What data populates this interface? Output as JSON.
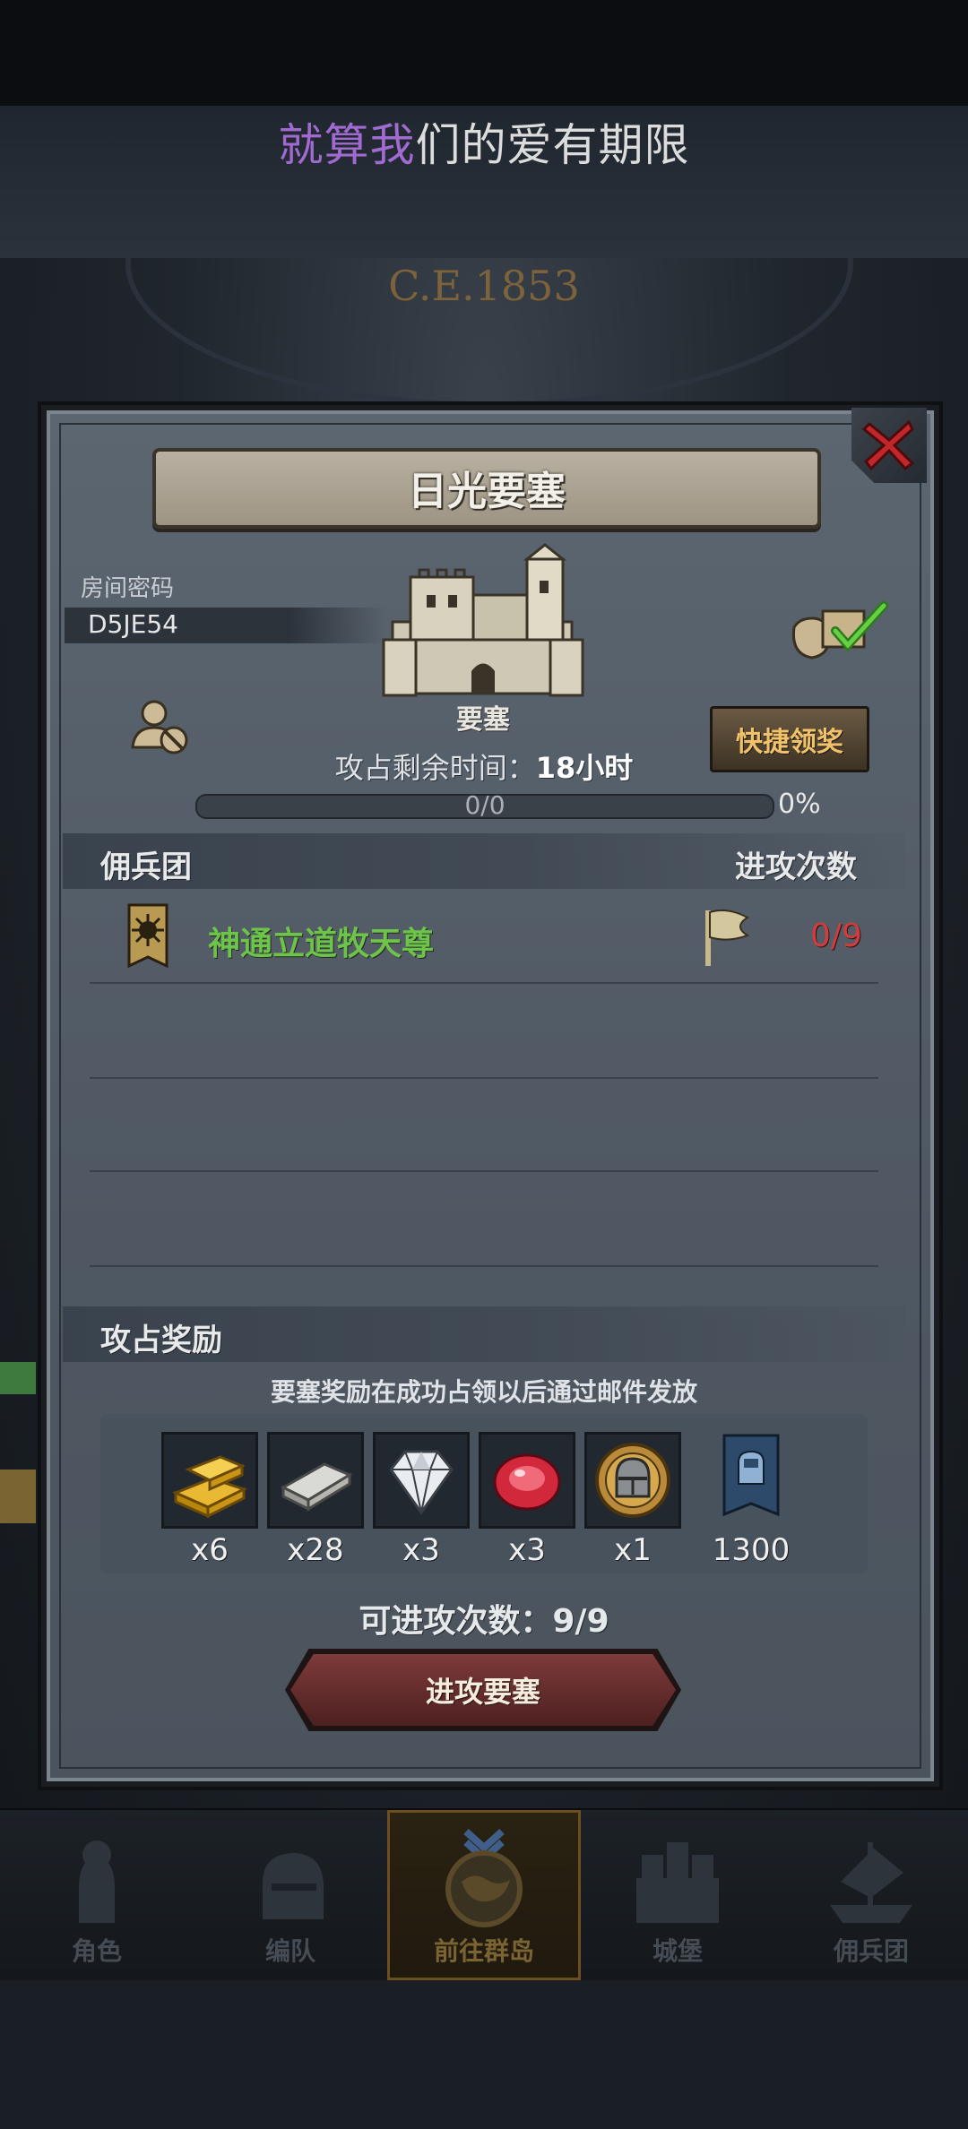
{
  "lyric": {
    "highlight": "就算我",
    "rest": "们的爱有期限"
  },
  "background": {
    "era_text": "C.E.1853"
  },
  "dialog": {
    "title": "日光要塞",
    "room_code_label": "房间密码",
    "room_code": "D5JE54",
    "building_label": "要塞",
    "claim_button": "快捷领奖",
    "time_label": "攻占剩余时间：",
    "time_value": "18小时",
    "progress_text": "0/0",
    "progress_fraction": 0,
    "progress_percent": "0%",
    "mercenary_header": "佣兵团",
    "attacks_header": "进攻次数",
    "mercenaries": [
      {
        "name": "神通立道牧天尊",
        "attacks": "0/9"
      }
    ],
    "rewards_header": "攻占奖励",
    "rewards_note": "要塞奖励在成功占领以后通过邮件发放",
    "rewards": [
      {
        "icon": "gold-bar-icon",
        "qty": "x6"
      },
      {
        "icon": "iron-bar-icon",
        "qty": "x28"
      },
      {
        "icon": "diamond-icon",
        "qty": "x3"
      },
      {
        "icon": "ruby-icon",
        "qty": "x3"
      },
      {
        "icon": "knight-helmet-coin-icon",
        "qty": "x1"
      },
      {
        "icon": "banner-point-icon",
        "qty": "1300"
      }
    ],
    "attack_count_label": "可进攻次数：",
    "attack_count_value": "9/9",
    "attack_button": "进攻要塞"
  },
  "nav": {
    "items": [
      {
        "label": "角色",
        "active": false
      },
      {
        "label": "编队",
        "active": false
      },
      {
        "label": "前往群岛",
        "active": true
      },
      {
        "label": "城堡",
        "active": false
      },
      {
        "label": "佣兵团",
        "active": false
      }
    ]
  },
  "colors": {
    "accent_gold": "#f2c26a",
    "merc_green": "#6ec44a",
    "count_red": "#d23c3c",
    "lyric_highlight": "#a06ad0"
  }
}
